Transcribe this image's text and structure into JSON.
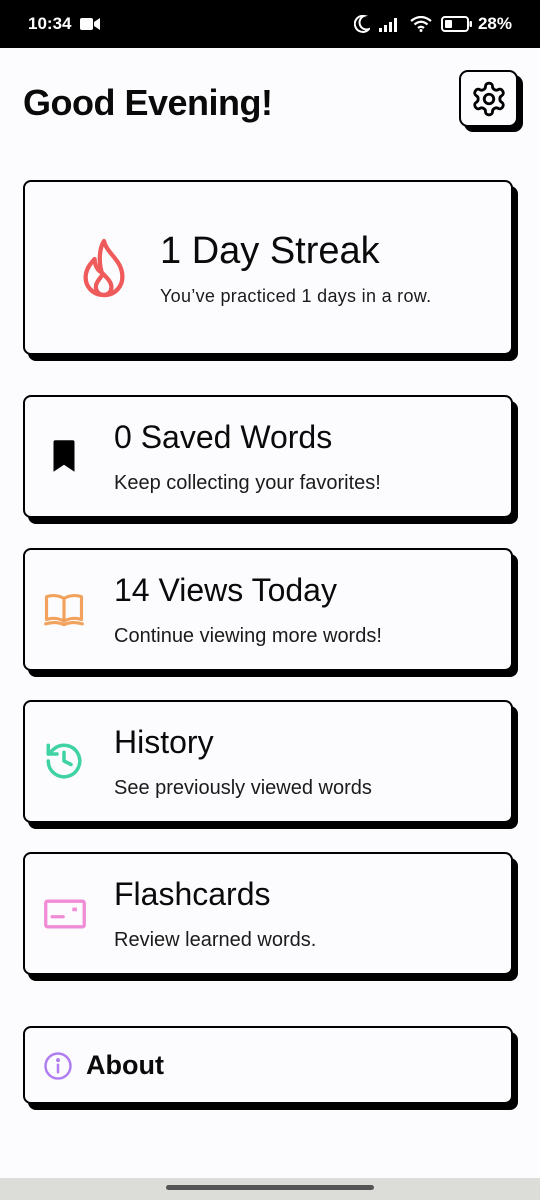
{
  "status_bar": {
    "time": "10:34",
    "battery_percent": "28%",
    "icons": [
      "video-camera-icon",
      "moon-icon",
      "signal-icon",
      "wifi-icon",
      "battery-icon"
    ]
  },
  "header": {
    "greeting": "Good Evening!",
    "settings_icon": "gear-icon"
  },
  "streak": {
    "title": "1 Day Streak",
    "subtitle": "You’ve practiced 1 days in a row.",
    "icon": "flame-icon",
    "color": "#ef5a5a"
  },
  "cards": {
    "saved": {
      "title": "0 Saved Words",
      "subtitle": "Keep collecting your favorites!",
      "icon": "bookmark-icon",
      "color": "#000000"
    },
    "views": {
      "title": "14 Views Today",
      "subtitle": "Continue viewing more words!",
      "icon": "open-book-icon",
      "color": "#f2a25c"
    },
    "history": {
      "title": "History",
      "subtitle": "See previously viewed words",
      "icon": "history-clock-icon",
      "color": "#3fd2a2"
    },
    "flashcards": {
      "title": "Flashcards",
      "subtitle": "Review learned words.",
      "icon": "flashcard-icon",
      "color": "#f08bd6"
    }
  },
  "about": {
    "label": "About",
    "icon": "info-icon",
    "color": "#b07ef0"
  }
}
